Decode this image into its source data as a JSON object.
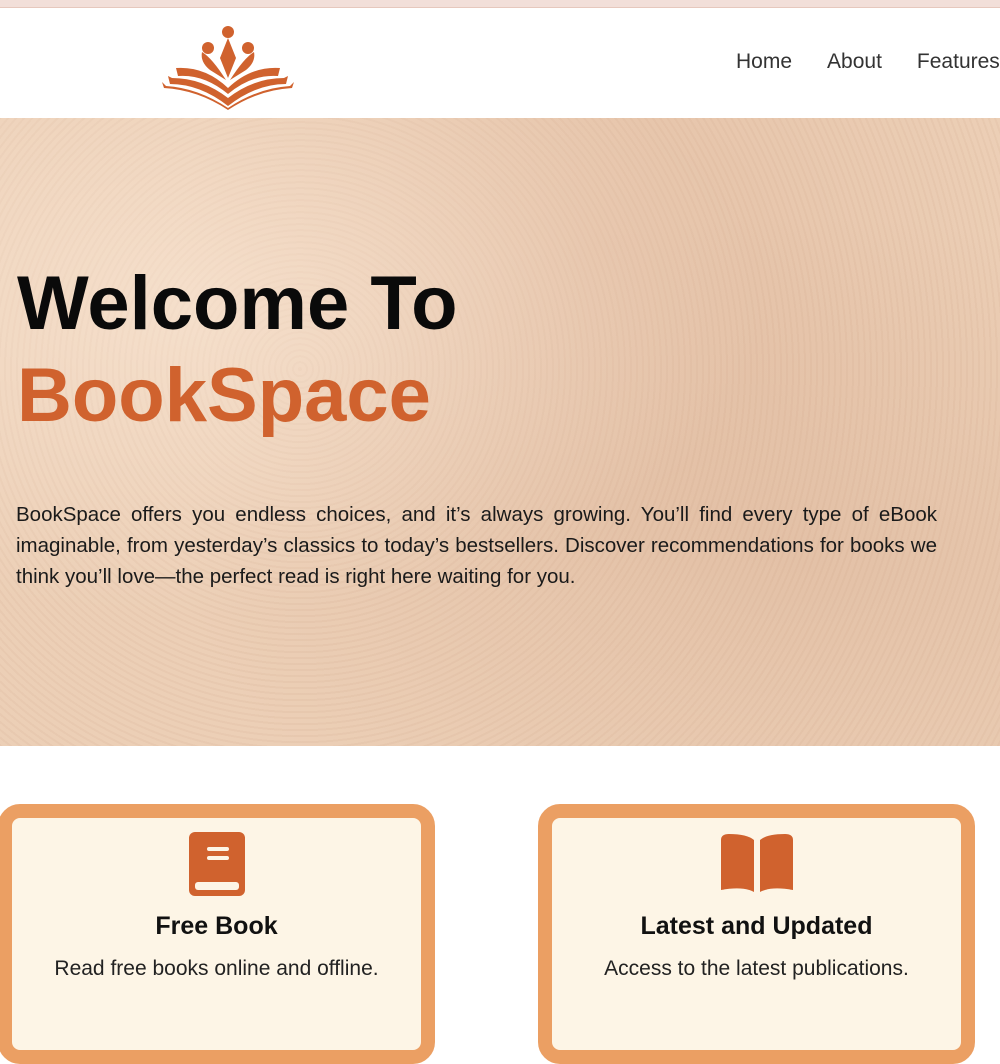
{
  "header": {
    "logo_alt": "BookSpace logo",
    "nav": [
      "Home",
      "About",
      "Features"
    ]
  },
  "hero": {
    "title_line1": "Welcome To",
    "title_line2": "BookSpace",
    "description": "BookSpace offers you endless choices, and it’s always growing. You’ll find every type of eBook imaginable, from yesterday’s classics to today’s bestsellers. Discover recommendations for books we think you’ll love—the perfect read is right here waiting for you."
  },
  "features": [
    {
      "icon": "book-icon",
      "title": "Free Book",
      "description": "Read free books online and offline."
    },
    {
      "icon": "open-book-icon",
      "title": "Latest and Updated",
      "description": "Access to the latest publications."
    }
  ],
  "colors": {
    "accent": "#d0622e",
    "card_border": "#eb9f63",
    "card_bg": "#fdf5e6"
  }
}
